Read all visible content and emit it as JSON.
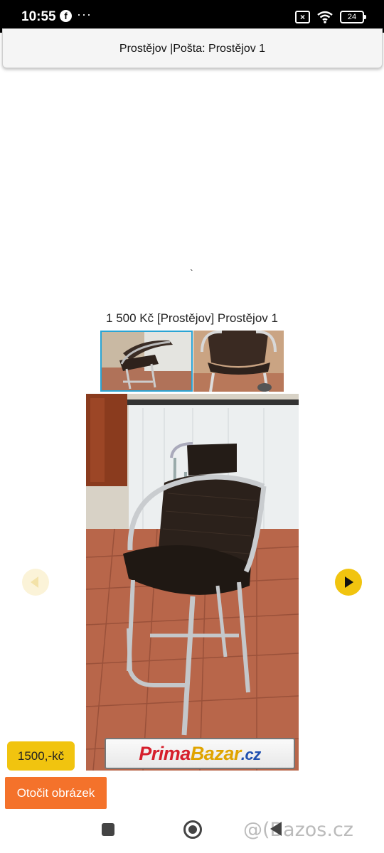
{
  "status_bar": {
    "time": "10:55",
    "app_icon": "facebook-icon",
    "more": "···",
    "battery": "24"
  },
  "header": {
    "location": "Prostějov |Pošta: Prostějov 1"
  },
  "stray_mark": "`",
  "listing": {
    "price_line": "1 500 Kč [Prostějov] Prostějov 1",
    "price_badge": "1500,-kč",
    "rotate_button": "Otočit obrázek"
  },
  "watermark": {
    "part1": "Prima",
    "part2": "Bazar",
    "part3": ".cz"
  },
  "nav_bar": {
    "brand": "@(Bazos.cz"
  },
  "colors": {
    "accent_yellow": "#f1c40f",
    "rotate_orange": "#f4722b",
    "thumb_selected": "#2aa4d4"
  }
}
